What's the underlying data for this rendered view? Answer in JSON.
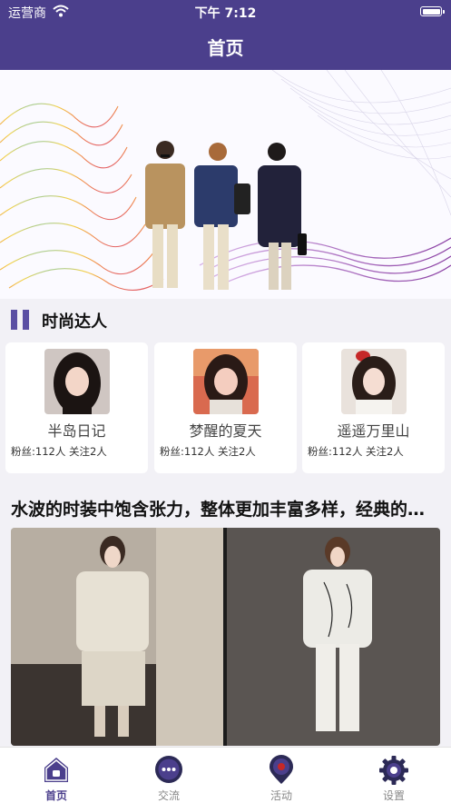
{
  "status": {
    "carrier": "运营商",
    "time": "下午 7:12"
  },
  "navbar": {
    "title": "首页"
  },
  "section": {
    "title": "时尚达人"
  },
  "influencers": [
    {
      "name": "半岛日记",
      "stats": "粉丝:112人  关注2人"
    },
    {
      "name": "梦醒的夏天",
      "stats": "粉丝:112人  关注2人"
    },
    {
      "name": "遥遥万里山",
      "stats": "粉丝:112人  关注2人"
    }
  ],
  "article": {
    "title": "水波的时装中饱含张力，整体更加丰富多样，经典的廓形与极简主义设计相结合"
  },
  "tabs": [
    {
      "label": "首页",
      "icon": "home-icon",
      "active": true
    },
    {
      "label": "交流",
      "icon": "chat-icon",
      "active": false
    },
    {
      "label": "活动",
      "icon": "location-icon",
      "active": false
    },
    {
      "label": "设置",
      "icon": "gear-icon",
      "active": false
    }
  ],
  "colors": {
    "primary": "#4b3f8c",
    "accent": "#5a4fa3",
    "background": "#f2f1f6"
  }
}
